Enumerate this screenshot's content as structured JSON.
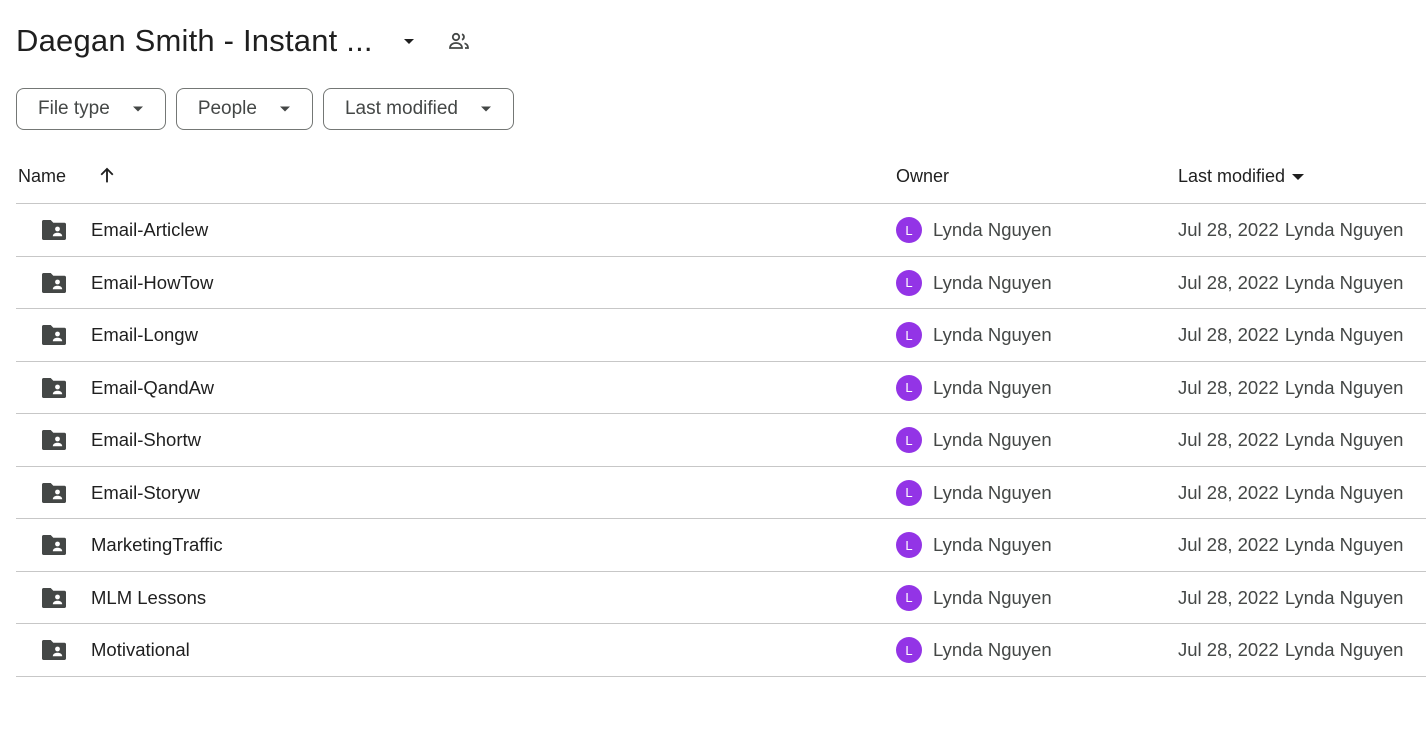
{
  "header": {
    "title": "Daegan Smith - Instant ...",
    "title_caret_icon": "arrow-drop-down-icon",
    "shared_icon": "people-icon"
  },
  "filters": [
    {
      "label": "File type"
    },
    {
      "label": "People"
    },
    {
      "label": "Last modified"
    }
  ],
  "table": {
    "columns": {
      "name": "Name",
      "owner": "Owner",
      "last_modified": "Last modified"
    },
    "sort_icon": "arrow-upward-icon",
    "rows": [
      {
        "name": "Email-Articlew",
        "owner_initial": "L",
        "owner": "Lynda Nguyen",
        "modified_date": "Jul 28, 2022",
        "modified_by": "Lynda Nguyen"
      },
      {
        "name": "Email-HowTow",
        "owner_initial": "L",
        "owner": "Lynda Nguyen",
        "modified_date": "Jul 28, 2022",
        "modified_by": "Lynda Nguyen"
      },
      {
        "name": "Email-Longw",
        "owner_initial": "L",
        "owner": "Lynda Nguyen",
        "modified_date": "Jul 28, 2022",
        "modified_by": "Lynda Nguyen"
      },
      {
        "name": "Email-QandAw",
        "owner_initial": "L",
        "owner": "Lynda Nguyen",
        "modified_date": "Jul 28, 2022",
        "modified_by": "Lynda Nguyen"
      },
      {
        "name": "Email-Shortw",
        "owner_initial": "L",
        "owner": "Lynda Nguyen",
        "modified_date": "Jul 28, 2022",
        "modified_by": "Lynda Nguyen"
      },
      {
        "name": "Email-Storyw",
        "owner_initial": "L",
        "owner": "Lynda Nguyen",
        "modified_date": "Jul 28, 2022",
        "modified_by": "Lynda Nguyen"
      },
      {
        "name": "MarketingTraffic",
        "owner_initial": "L",
        "owner": "Lynda Nguyen",
        "modified_date": "Jul 28, 2022",
        "modified_by": "Lynda Nguyen"
      },
      {
        "name": "MLM Lessons",
        "owner_initial": "L",
        "owner": "Lynda Nguyen",
        "modified_date": "Jul 28, 2022",
        "modified_by": "Lynda Nguyen"
      },
      {
        "name": "Motivational",
        "owner_initial": "L",
        "owner": "Lynda Nguyen",
        "modified_date": "Jul 28, 2022",
        "modified_by": "Lynda Nguyen"
      }
    ]
  },
  "colors": {
    "avatar": "#9334e6",
    "folder": "#444746",
    "divider": "#c7c7c7"
  }
}
